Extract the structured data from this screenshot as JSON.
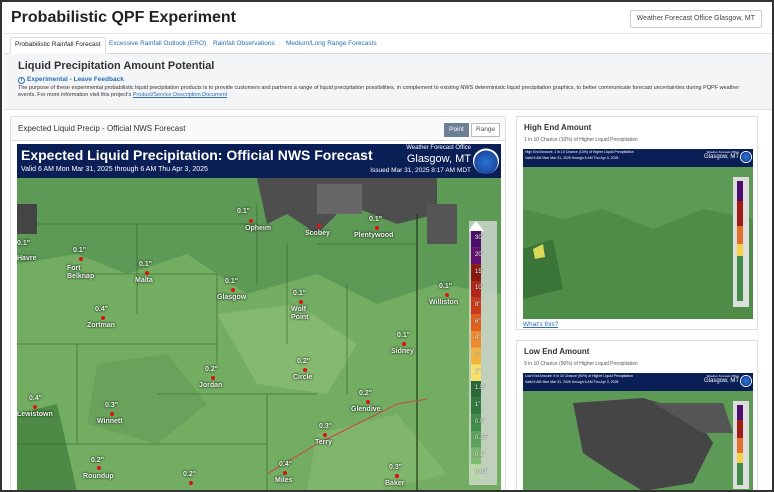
{
  "app": {
    "title": "Probabilistic QPF Experiment",
    "office_button": "Weather Forecast Office Glasgow, MT"
  },
  "tabs": [
    {
      "label": "Probabilistic Rainfall Forecast",
      "active": true
    },
    {
      "label": "Excessive Rainfall Outlook (ERO)",
      "active": false
    },
    {
      "label": "Rainfall Observations",
      "active": false
    },
    {
      "label": "Medium/Long Range Forecasts",
      "active": false
    }
  ],
  "intro": {
    "title": "Liquid Precipitation Amount Potential",
    "feedback_link": "Experimental - Leave Feedback",
    "purpose_text": "The purpose of these experimental probabilistic liquid precipitation products is to provide customers and partners a range of liquid precipitation possibilities, in complement to existing NWS deterministic liquid precipitation graphics, to better communicate forecast uncertainties during PQPF weather events. For more information visit this project's",
    "purpose_link": "Product/Service Description Document"
  },
  "main_card": {
    "title": "Expected Liquid Precip - Official NWS Forecast",
    "point_label": "Point",
    "range_label": "Range",
    "map": {
      "title": "Expected Liquid Precipitation: Official NWS Forecast",
      "valid": "Valid 6 AM Mon Mar 31, 2025 through 6 AM Thu Apr 3, 2025",
      "office_label": "Weather Forecast Office",
      "office_location": "Glasgow, MT",
      "issued": "Issued Mar 31, 2025 8:17 AM MDT",
      "scale": [
        "30\"",
        "20\"",
        "15\"",
        "10\"",
        "8\"",
        "6\"",
        "4\"",
        "3\"",
        "2\"",
        "1.5\"",
        "1\"",
        "0.5\"",
        "0.25\"",
        "0.1\"",
        "0.01\""
      ],
      "scale_colors": [
        "#4b0f6b",
        "#651073",
        "#8a1a10",
        "#b0281a",
        "#cc3a1a",
        "#df5d1d",
        "#ec8b2e",
        "#f4b53e",
        "#f6e06a",
        "#2a6a3a",
        "#2f7a3c",
        "#3f8d46",
        "#5aa35a",
        "#7db971",
        "#b8d8a8"
      ],
      "cities": [
        {
          "name": "Opheim",
          "value": "0.1\""
        },
        {
          "name": "Scobey",
          "value": ""
        },
        {
          "name": "Plentywood",
          "value": "0.1\""
        },
        {
          "name": "Havre",
          "value": "0.1\""
        },
        {
          "name": "Fort Belknap",
          "value": "0.1\""
        },
        {
          "name": "Malta",
          "value": "0.1\""
        },
        {
          "name": "Glasgow",
          "value": "0.1\""
        },
        {
          "name": "Wolf Point",
          "value": "0.1\""
        },
        {
          "name": "Williston",
          "value": "0.1\""
        },
        {
          "name": "Zortman",
          "value": "0.4\""
        },
        {
          "name": "Sidney",
          "value": "0.1\""
        },
        {
          "name": "Jordan",
          "value": "0.2\""
        },
        {
          "name": "Circle",
          "value": "0.2\""
        },
        {
          "name": "Lewistown",
          "value": "0.4\""
        },
        {
          "name": "Winnett",
          "value": "0.3\""
        },
        {
          "name": "Glendive",
          "value": "0.2\""
        },
        {
          "name": "Terry",
          "value": "0.3\""
        },
        {
          "name": "Roundup",
          "value": "0.2\""
        },
        {
          "name": "Miles",
          "value": "0.4\""
        },
        {
          "name": "Baker",
          "value": "0.3\""
        },
        {
          "name": "",
          "value": "0.2\""
        }
      ]
    }
  },
  "high_end": {
    "title": "High End Amount",
    "subtitle": "1 in 10 Chance (10%) of Higher Liquid Precipitation",
    "thumb_text": "High End Amount: 1 in 10 Chance (10%) of Higher Liquid Precipitation",
    "thumb_valid": "Valid 6 AM Mon Mar 31, 2025 through 6 AM Thu Apr 3, 2025",
    "whats_this": "What's this?"
  },
  "low_end": {
    "title": "Low End Amount",
    "subtitle": "9 in 10 Chance (90%) of Higher Liquid Precipitation",
    "thumb_text": "Low End Amount: 9 in 10 Chance (90%) of Higher Liquid Precipitation",
    "thumb_valid": "Valid 6 AM Mon Mar 31, 2025 through 6 AM Thu Apr 3, 2025"
  }
}
